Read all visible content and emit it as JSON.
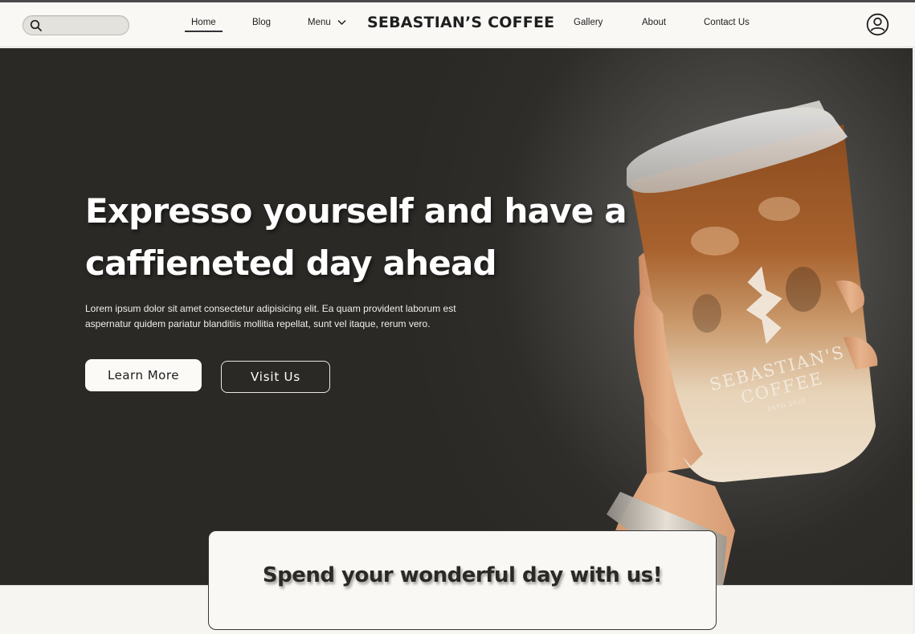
{
  "header": {
    "search": {
      "placeholder": "",
      "value": "",
      "icon": "search-icon"
    },
    "nav_left": [
      {
        "label": "Home",
        "active": true
      },
      {
        "label": "Blog",
        "active": false
      },
      {
        "label": "Menu",
        "active": false,
        "icon": "chevron-down-icon"
      }
    ],
    "brand": "SEBASTIAN’S COFFEE",
    "nav_right": [
      {
        "label": "Gallery"
      },
      {
        "label": "About"
      },
      {
        "label": "Contact Us"
      }
    ],
    "account_icon": "user-account-icon"
  },
  "hero": {
    "title_line1": "Expresso yourself and have a",
    "title_line2": "caffieneted day ahead",
    "text_line1": "Lorem ipsum dolor sit amet consectetur adipisicing elit. Ea quam provident laborum est",
    "text_line2": "aspernatur quidem pariatur blanditiis mollitia repellat, sunt vel itaque, rerum vero.",
    "primary_button": "Learn More",
    "secondary_button": "Visit Us",
    "cup_logo": {
      "line1": "SEBASTIAN'S",
      "line2": "COFFEE",
      "line3": "ESTD 2020"
    }
  },
  "banner": {
    "text": "Spend your wonderful day with us!"
  },
  "colors": {
    "hero_background": "#2b2925",
    "header_background": "#f9f8f5",
    "text_light": "#ffffff",
    "text_dark": "#1e1e1e"
  }
}
